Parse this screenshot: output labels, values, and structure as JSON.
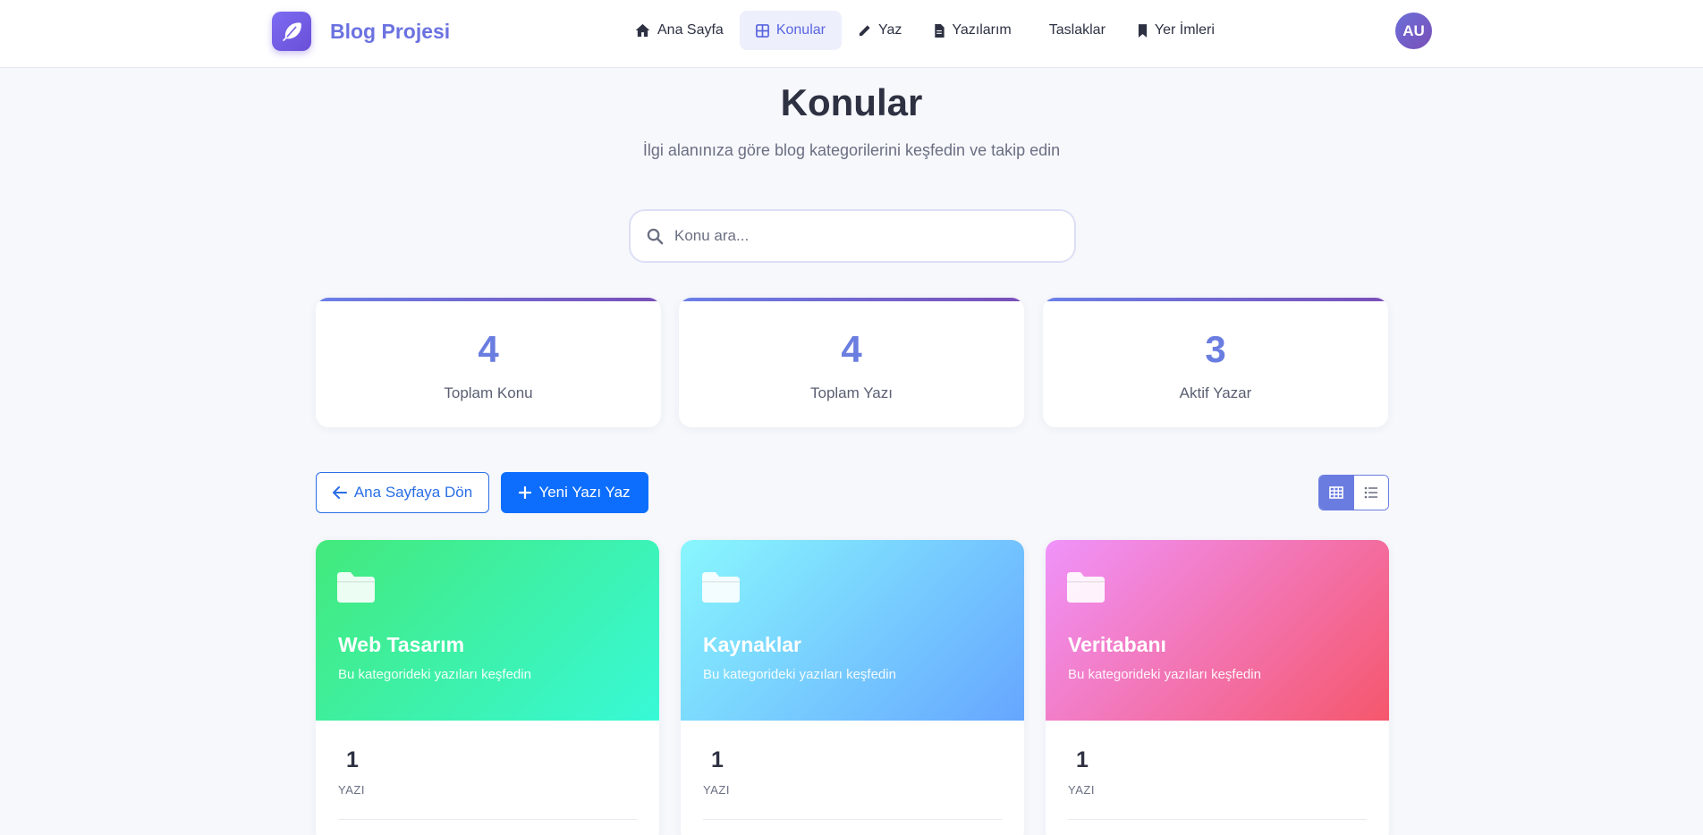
{
  "nav": {
    "brand": "Blog Projesi",
    "links": [
      {
        "label": "Ana Sayfa",
        "icon": "home-icon",
        "active": false
      },
      {
        "label": "Konular",
        "icon": "grid-icon",
        "active": true
      },
      {
        "label": "Yaz",
        "icon": "pencil-icon",
        "active": false
      },
      {
        "label": "Yazılarım",
        "icon": "file-icon",
        "active": false
      },
      {
        "label": "Taslaklar",
        "icon": "",
        "active": false
      },
      {
        "label": "Yer İmleri",
        "icon": "bookmark-icon",
        "active": false
      }
    ],
    "avatar_initials": "AU"
  },
  "header": {
    "title": "Konular",
    "subtitle": "İlgi alanınıza göre blog kategorilerini keşfedin ve takip edin"
  },
  "search": {
    "placeholder": "Konu ara...",
    "value": ""
  },
  "stats": [
    {
      "value": "4",
      "label": "Toplam Konu"
    },
    {
      "value": "4",
      "label": "Toplam Yazı"
    },
    {
      "value": "3",
      "label": "Aktif Yazar"
    }
  ],
  "actions": {
    "back_label": "Ana Sayfaya Dön",
    "new_post_label": "Yeni Yazı Yaz",
    "view_mode": "grid"
  },
  "topics": [
    {
      "name": "Web Tasarım",
      "description": "Bu kategorideki yazıları keşfedin",
      "count": "1",
      "unit": "YAZI",
      "gradient": [
        "#43e97b",
        "#38f9d7"
      ]
    },
    {
      "name": "Kaynaklar",
      "description": "Bu kategorideki yazıları keşfedin",
      "count": "1",
      "unit": "YAZI",
      "gradient": [
        "#89f7fe",
        "#66a6ff"
      ]
    },
    {
      "name": "Veritabanı",
      "description": "Bu kategorideki yazıları keşfedin",
      "count": "1",
      "unit": "YAZI",
      "gradient": [
        "#f093fb",
        "#f5576c"
      ]
    }
  ],
  "colors": {
    "brand": "#6b72e0",
    "primary": "#0d6efd",
    "stat_value": "#6a7de0"
  }
}
